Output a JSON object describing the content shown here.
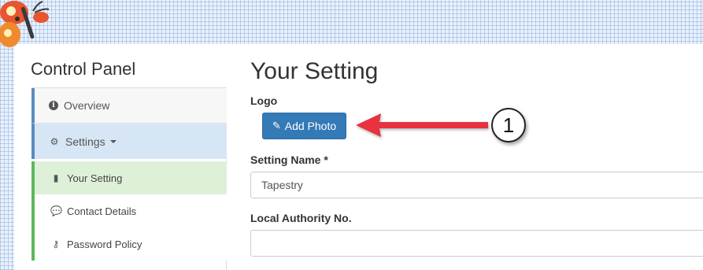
{
  "sidebar": {
    "title": "Control Panel",
    "items": [
      {
        "label": "Overview",
        "icon": "info-icon"
      },
      {
        "label": "Settings",
        "icon": "gear-icon"
      }
    ],
    "subitems": [
      {
        "label": "Your Setting",
        "icon": "book-icon"
      },
      {
        "label": "Contact Details",
        "icon": "speech-bubble-icon"
      },
      {
        "label": "Password Policy",
        "icon": "key-icon"
      }
    ]
  },
  "main": {
    "title": "Your Setting",
    "logo_label": "Logo",
    "add_photo_label": "Add Photo",
    "setting_name_label": "Setting Name *",
    "setting_name_value": "Tapestry",
    "local_authority_label": "Local Authority No.",
    "local_authority_value": ""
  },
  "annotation": {
    "step_number": "1"
  },
  "colors": {
    "primary_button": "#337ab7",
    "active_sub_bg": "#dff0d8",
    "settings_bg": "#d6e6f5",
    "arrow": "#e8333f"
  }
}
